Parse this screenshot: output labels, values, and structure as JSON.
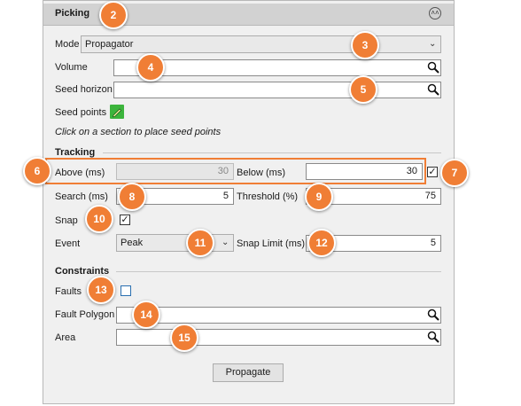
{
  "panel": {
    "title": "Picking"
  },
  "mode": {
    "label": "Mode",
    "value": "Propagator"
  },
  "volume": {
    "label": "Volume",
    "value": ""
  },
  "seed_horizon": {
    "label": "Seed horizon",
    "value": ""
  },
  "seed_points": {
    "label": "Seed points",
    "hint": "Click on a section to place seed points"
  },
  "tracking": {
    "title": "Tracking",
    "above": {
      "label": "Above (ms)",
      "value": "30"
    },
    "below": {
      "label": "Below (ms)",
      "value": "30",
      "checked": true
    },
    "search": {
      "label": "Search (ms)",
      "value": "5"
    },
    "threshold": {
      "label": "Threshold (%)",
      "value": "75"
    },
    "snap": {
      "label": "Snap",
      "checked": true
    },
    "event": {
      "label": "Event",
      "value": "Peak"
    },
    "snap_limit": {
      "label": "Snap Limit (ms)",
      "value": "5"
    }
  },
  "constraints": {
    "title": "Constraints",
    "faults": {
      "label": "Faults",
      "checked": false
    },
    "fault_polygon": {
      "label": "Fault Polygon",
      "value": ""
    },
    "area": {
      "label": "Area",
      "value": ""
    }
  },
  "propagate_button": {
    "label": "Propagate"
  },
  "callouts": [
    "2",
    "3",
    "4",
    "5",
    "6",
    "7",
    "8",
    "9",
    "10",
    "11",
    "12",
    "13",
    "14",
    "15"
  ],
  "colors": {
    "callout": "#f07e35",
    "panel_bg": "#f0f0f0",
    "header_bg": "#d2d2d2",
    "seed_icon": "#3cb43c"
  },
  "icons": [
    "collapse-icon",
    "chevron-down-icon",
    "search-icon",
    "pencil-icon",
    "checkmark-icon"
  ]
}
